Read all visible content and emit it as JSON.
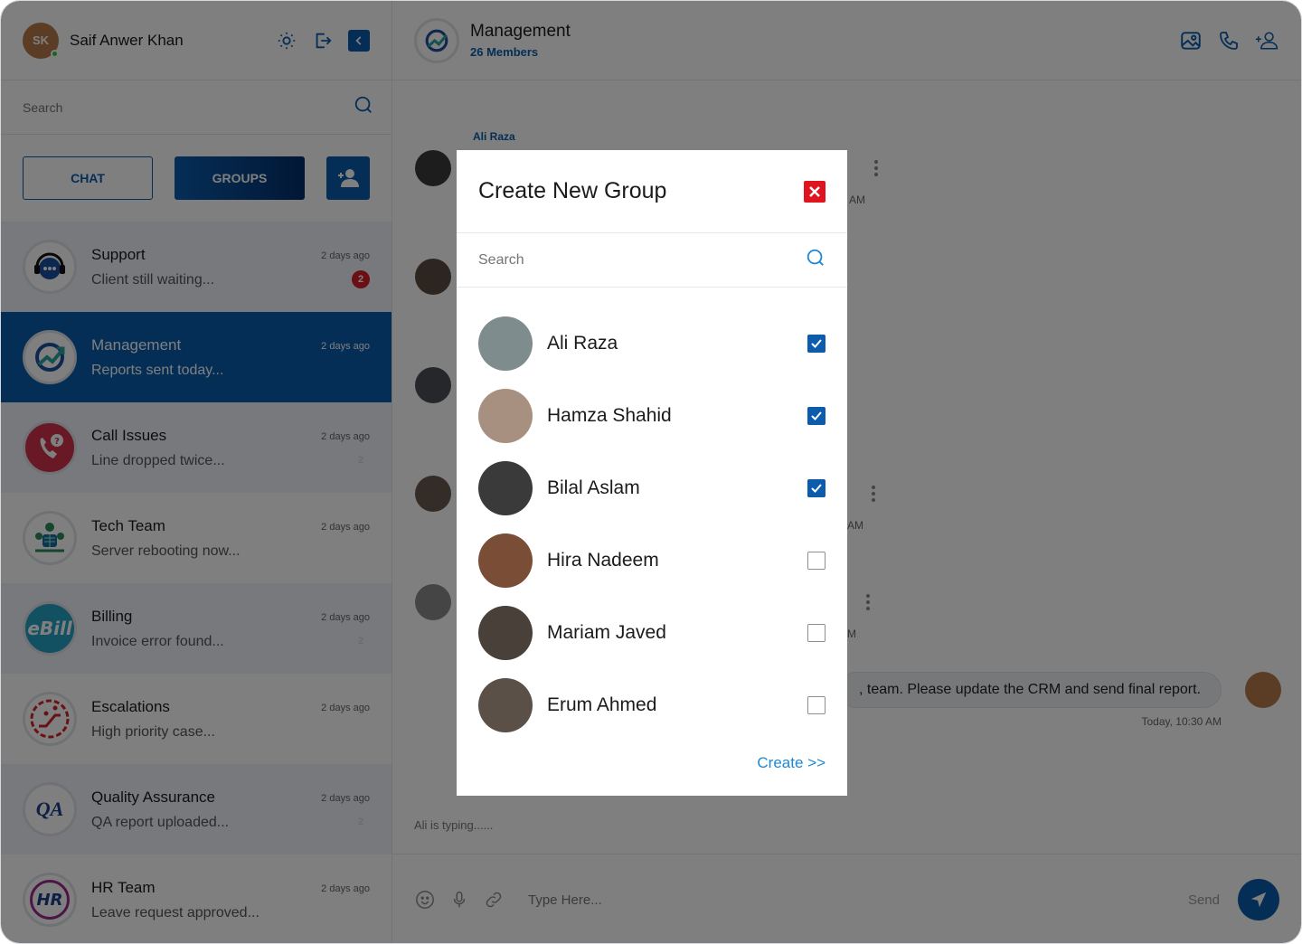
{
  "user": {
    "name": "Saif Anwer Khan",
    "initials": "SK"
  },
  "sidebar": {
    "search_placeholder": "Search",
    "tab_chat": "CHAT",
    "tab_groups": "GROUPS",
    "items": [
      {
        "title": "Support",
        "preview": "Client still waiting...",
        "time": "2 days ago",
        "badge": "2",
        "icon": "headset-chat-icon",
        "active": false
      },
      {
        "title": "Management",
        "preview": "Reports sent today...",
        "time": "2 days ago",
        "badge": "",
        "icon": "growth-chart-icon",
        "active": true
      },
      {
        "title": "Call Issues",
        "preview": "Line dropped twice...",
        "time": "2 days ago",
        "badge": "2",
        "icon": "phone-question-icon",
        "active": false
      },
      {
        "title": "Tech Team",
        "preview": "Server rebooting now...",
        "time": "2 days ago",
        "badge": "",
        "icon": "team-network-icon",
        "active": false
      },
      {
        "title": "Billing",
        "preview": "Invoice error found...",
        "time": "2 days ago",
        "badge": "2",
        "icon": "ebill-logo",
        "active": false
      },
      {
        "title": "Escalations",
        "preview": "High priority case...",
        "time": "2 days ago",
        "badge": "",
        "icon": "escalator-icon",
        "active": false
      },
      {
        "title": "Quality Assurance",
        "preview": "QA report uploaded...",
        "time": "2 days ago",
        "badge": "2",
        "icon": "qa-logo",
        "active": false
      },
      {
        "title": "HR Team",
        "preview": "Leave request approved...",
        "time": "2 days ago",
        "badge": "",
        "icon": "hr-logo",
        "active": false
      }
    ],
    "ebill_text": "eBill",
    "qa_text": "QA",
    "hr_text": "HR"
  },
  "chat": {
    "title": "Management",
    "members": "26 Members",
    "first_sender": "Ali Raza",
    "fragments": [
      "AM",
      "AM",
      "M"
    ],
    "right_message": ", team. Please update the CRM and send final report.",
    "right_time": "Today, 10:30 AM",
    "typing": "Ali is typing......",
    "input_placeholder": "Type Here...",
    "send_label": "Send"
  },
  "modal": {
    "title": "Create New Group",
    "search_placeholder": "Search",
    "members": [
      {
        "name": "Ali Raza",
        "checked": true,
        "color": "#7f8c8d"
      },
      {
        "name": "Hamza Shahid",
        "checked": true,
        "color": "#a89080"
      },
      {
        "name": "Bilal Aslam",
        "checked": true,
        "color": "#3a3a3a"
      },
      {
        "name": "Hira Nadeem",
        "checked": false,
        "color": "#7a4e36"
      },
      {
        "name": "Mariam Javed",
        "checked": false,
        "color": "#4a403a"
      },
      {
        "name": "Erum Ahmed",
        "checked": false,
        "color": "#5a5048"
      }
    ],
    "create_label": "Create >>"
  },
  "colors": {
    "primary": "#0b5cad",
    "badge": "#d91f2a",
    "close": "#e0141e",
    "link": "#1e88d6"
  }
}
